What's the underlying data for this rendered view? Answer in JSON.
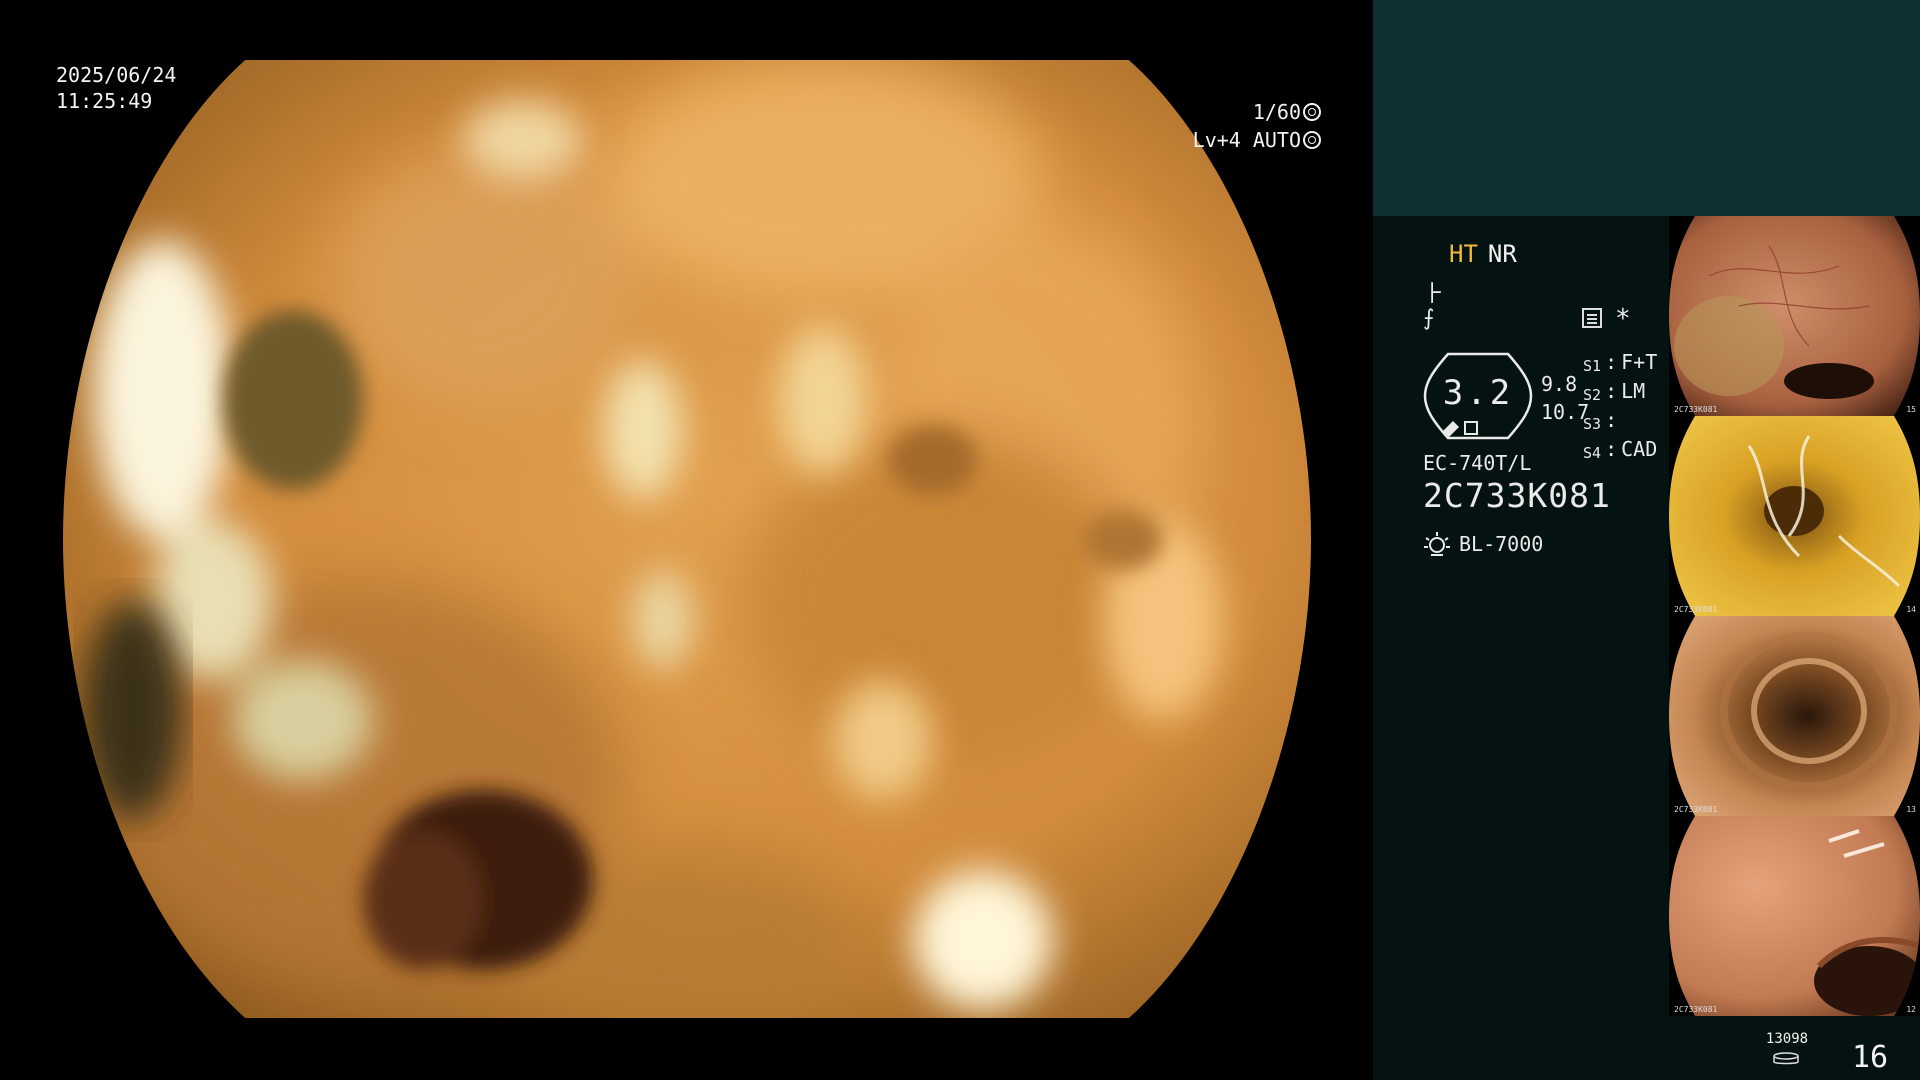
{
  "overlay": {
    "date": "2025/06/24",
    "time": "11:25:49",
    "shutter": "1/60",
    "level": "Lv+4",
    "exposure_mode": "AUTO"
  },
  "panel": {
    "mode_ht": "HT",
    "mode_nr": "NR",
    "zoom_value": "3.2",
    "zoom_a": "9.8",
    "zoom_b": "10.7",
    "switches": [
      {
        "key": "S1",
        "value": "F+T"
      },
      {
        "key": "S2",
        "value": "LM"
      },
      {
        "key": "S3",
        "value": ""
      },
      {
        "key": "S4",
        "value": "CAD"
      }
    ],
    "scope_model": "EC-740T/L",
    "scope_serial": "2C733K081",
    "light_source": "BL-7000",
    "star_label": "*",
    "glyph_1": "⺊",
    "glyph_2": "⨍"
  },
  "thumbnails": [
    {
      "caption": "2C733K081",
      "number": "15"
    },
    {
      "caption": "2C733K081",
      "number": "14"
    },
    {
      "caption": "2C733K081",
      "number": "13"
    },
    {
      "caption": "2C733K081",
      "number": "12"
    }
  ],
  "footer": {
    "storage_value": "13098",
    "image_count": "16"
  },
  "colors": {
    "panel_bg": "#041311",
    "panel_top": "#0d3030",
    "ht_accent": "#f2b93a"
  }
}
